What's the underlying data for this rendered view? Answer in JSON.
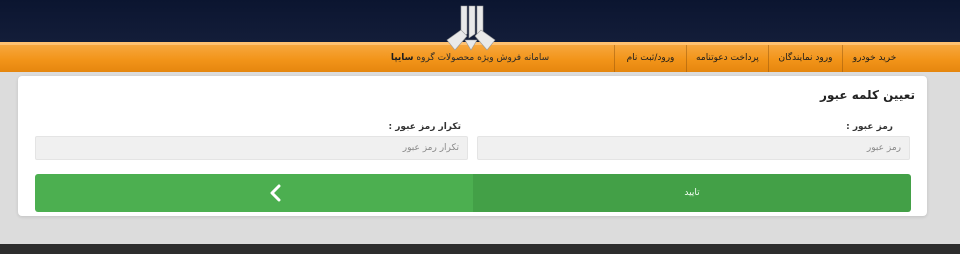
{
  "header": {
    "logo_icon": "saipa-logo-icon"
  },
  "nav": {
    "items": [
      "خرید خودرو",
      "ورود نمایندگان",
      "پرداخت دعوتنامه",
      "ورود/ثبت نام"
    ],
    "brand_prefix": "سامانه فروش ویژه محصولات گروه",
    "brand_name": "سایپا"
  },
  "form": {
    "title": "تعیین کلمه عبور",
    "password_label": "رمز عبور :",
    "password_placeholder": "رمز عبور",
    "confirm_label": "تکرار رمز عبور :",
    "confirm_placeholder": "تکرار رمز عبور",
    "submit_label": "تایید",
    "back_icon": "chevron-left-icon"
  },
  "colors": {
    "header_bg": "#0b1530",
    "nav_orange": "#f29419",
    "button_green": "#4caf50",
    "button_green_dark": "#43a047"
  }
}
